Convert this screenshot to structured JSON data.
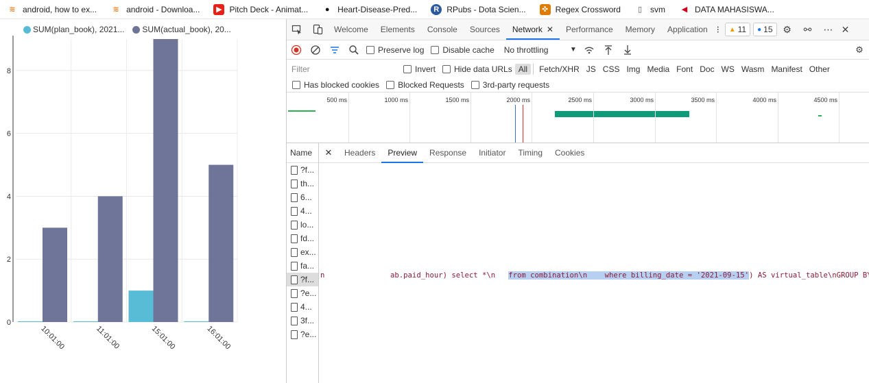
{
  "bookmarks": [
    {
      "label": "android, how to ex...",
      "icon": "stackoverflow-icon"
    },
    {
      "label": "android - Downloa...",
      "icon": "stackoverflow-icon"
    },
    {
      "label": "Pitch Deck - Animat...",
      "icon": "youtube-icon"
    },
    {
      "label": "Heart-Disease-Pred...",
      "icon": "github-icon"
    },
    {
      "label": "RPubs - Dota Scien...",
      "icon": "rpubs-icon"
    },
    {
      "label": "Regex Crossword",
      "icon": "regex-crossword-icon"
    },
    {
      "label": "svm",
      "icon": "page-icon"
    },
    {
      "label": "DATA MAHASISWA...",
      "icon": "data-icon"
    }
  ],
  "chart_data": {
    "type": "bar",
    "categories": [
      "10:01:00",
      "11:01:00",
      "15:01:00",
      "16:01:00"
    ],
    "series": [
      {
        "name": "SUM(plan_book), 2021...",
        "color": "#59bcd6",
        "values": [
          0,
          0,
          1,
          0
        ]
      },
      {
        "name": "SUM(actual_book), 20...",
        "color": "#6e7599",
        "values": [
          3,
          4,
          9,
          5
        ]
      }
    ],
    "yticks": [
      "0",
      "2",
      "4",
      "6",
      "8"
    ],
    "ylim": [
      0,
      9
    ],
    "grid": true,
    "legend_position": "top-left"
  },
  "devtools": {
    "tabs": [
      "Welcome",
      "Elements",
      "Console",
      "Sources",
      "Network",
      "Performance",
      "Memory",
      "Application"
    ],
    "active_tab": "Network",
    "warnings_count": "11",
    "messages_count": "15",
    "toolbar": {
      "preserve_log": "Preserve log",
      "disable_cache": "Disable cache",
      "throttling": "No throttling"
    },
    "filter": {
      "placeholder": "Filter",
      "invert": "Invert",
      "hide_data_urls": "Hide data URLs",
      "types": [
        "All",
        "Fetch/XHR",
        "JS",
        "CSS",
        "Img",
        "Media",
        "Font",
        "Doc",
        "WS",
        "Wasm",
        "Manifest",
        "Other"
      ],
      "active_type": "All",
      "has_blocked_cookies": "Has blocked cookies",
      "blocked_requests": "Blocked Requests",
      "third_party": "3rd-party requests"
    },
    "overview_ticks": [
      "500 ms",
      "1000 ms",
      "1500 ms",
      "2000 ms",
      "2500 ms",
      "3000 ms",
      "3500 ms",
      "4000 ms",
      "4500 ms"
    ],
    "name_header": "Name",
    "requests": [
      "?f...",
      "th...",
      "6...",
      "4...",
      "lo...",
      "fd...",
      "ex...",
      "fa...",
      "?f...",
      "?e...",
      "4...",
      "3f...",
      "?e..."
    ],
    "selected_request_index": 8,
    "detail_tabs": [
      "Headers",
      "Preview",
      "Response",
      "Initiator",
      "Timing",
      "Cookies"
    ],
    "active_detail_tab": "Preview",
    "preview": {
      "before": "n               ab.paid_hour) select *\\n   ",
      "highlighted": "from combination\\n    where billing_date = '2021-09-15'",
      "after": ") AS virtual_table\\nGROUP BY paid"
    }
  }
}
